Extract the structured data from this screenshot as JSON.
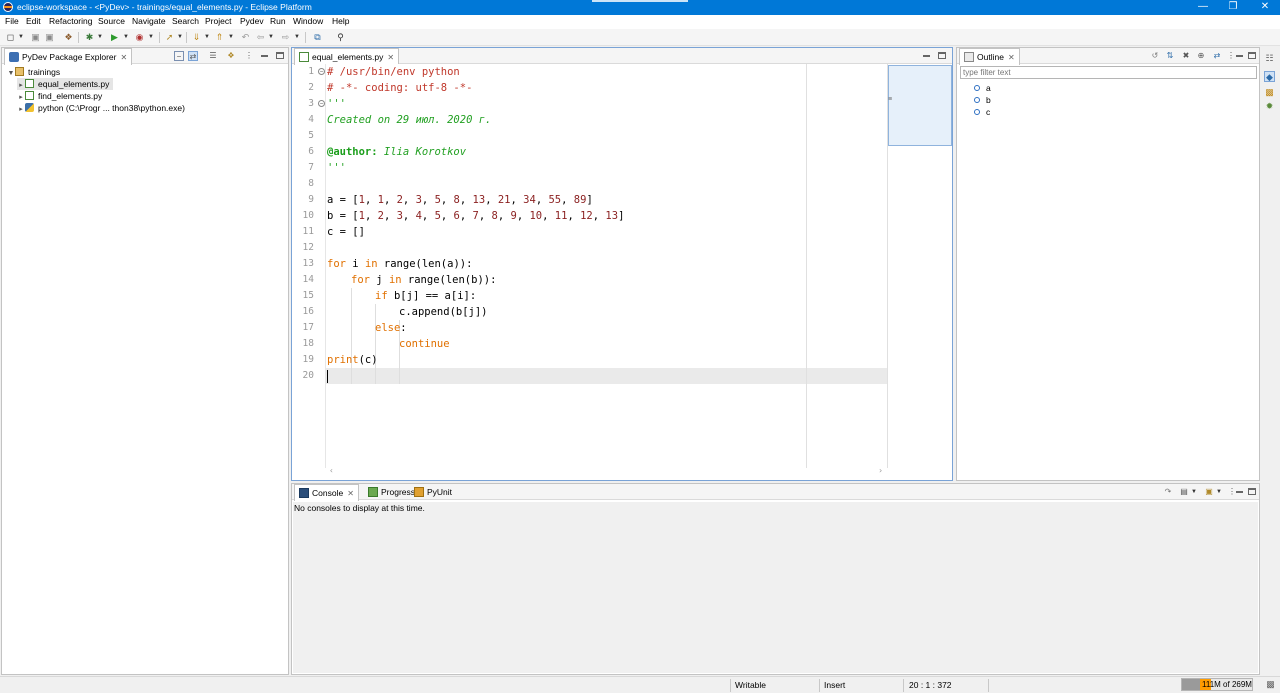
{
  "window": {
    "title": "eclipse-workspace - <PyDev> - trainings/equal_elements.py - Eclipse Platform"
  },
  "menu": [
    "File",
    "Edit",
    "Refactoring",
    "Source",
    "Navigate",
    "Search",
    "Project",
    "Pydev",
    "Run",
    "Window",
    "Help"
  ],
  "explorer": {
    "tab_label": "PyDev Package Explorer",
    "items": [
      {
        "label": "trainings",
        "icon": "project-icon",
        "expanded": true
      },
      {
        "label": "equal_elements.py",
        "icon": "python-file-icon",
        "selected": true
      },
      {
        "label": "find_elements.py",
        "icon": "python-file-icon"
      },
      {
        "label": "python  (C:\\Progr ... thon38\\python.exe)",
        "icon": "python-interpreter-icon"
      }
    ]
  },
  "editor": {
    "tab_label": "equal_elements.py",
    "current_line": 20,
    "lines": [
      {
        "n": "1",
        "fold": true
      },
      {
        "n": "2"
      },
      {
        "n": "3",
        "fold": true
      },
      {
        "n": "4"
      },
      {
        "n": "5"
      },
      {
        "n": "6"
      },
      {
        "n": "7"
      },
      {
        "n": "8"
      },
      {
        "n": "9"
      },
      {
        "n": "10"
      },
      {
        "n": "11"
      },
      {
        "n": "12"
      },
      {
        "n": "13"
      },
      {
        "n": "14"
      },
      {
        "n": "15"
      },
      {
        "n": "16"
      },
      {
        "n": "17"
      },
      {
        "n": "18"
      },
      {
        "n": "19"
      },
      {
        "n": "20"
      }
    ],
    "code": {
      "l1": "# /usr/bin/env python",
      "l2": "# -*- coding: utf-8 -*-",
      "l3": "'''",
      "l4": "Created on 29 июл. 2020 г.",
      "l6_dec": "@author:",
      "l6_name": " Ilia Korotkov",
      "l7": "'''",
      "l9_a": "a",
      "l9_eq": " = [",
      "l9_vals": [
        "1",
        "1",
        "2",
        "3",
        "5",
        "8",
        "13",
        "21",
        "34",
        "55",
        "89"
      ],
      "l10_b": "b",
      "l10_vals": [
        "1",
        "2",
        "3",
        "4",
        "5",
        "6",
        "7",
        "8",
        "9",
        "10",
        "11",
        "12",
        "13"
      ],
      "l11": "c = []",
      "l13_for": "for",
      "l13_var": " i ",
      "l13_in": "in",
      "l13_rest": " range(len(a)):",
      "l14_for": "for",
      "l14_var": " j ",
      "l14_in": "in",
      "l14_rest": " range(len(b)):",
      "l15_if": "if",
      "l15_rest": " b[j] == a[i]:",
      "l16_rest": "c.append(b[j])",
      "l17_else": "else",
      "l17_colon": ":",
      "l18_cont": "continue",
      "l19_print": "print",
      "l19_rest": "(c)"
    }
  },
  "outline": {
    "tab_label": "Outline",
    "filter_placeholder": "type filter text",
    "items": [
      "a",
      "b",
      "c"
    ]
  },
  "console": {
    "tabs": [
      "Console",
      "Progress",
      "PyUnit"
    ],
    "message": "No consoles to display at this time."
  },
  "status": {
    "writable": "Writable",
    "insert_mode": "Insert",
    "position": "20 : 1 : 372",
    "heap": "111M of 269M",
    "heap_used_fraction": 0.41
  },
  "colors": {
    "titlebar": "#0078d7",
    "comment": "#c0382b",
    "string": "#22a022",
    "keyword": "#e07000",
    "number": "#8a1f1f"
  }
}
